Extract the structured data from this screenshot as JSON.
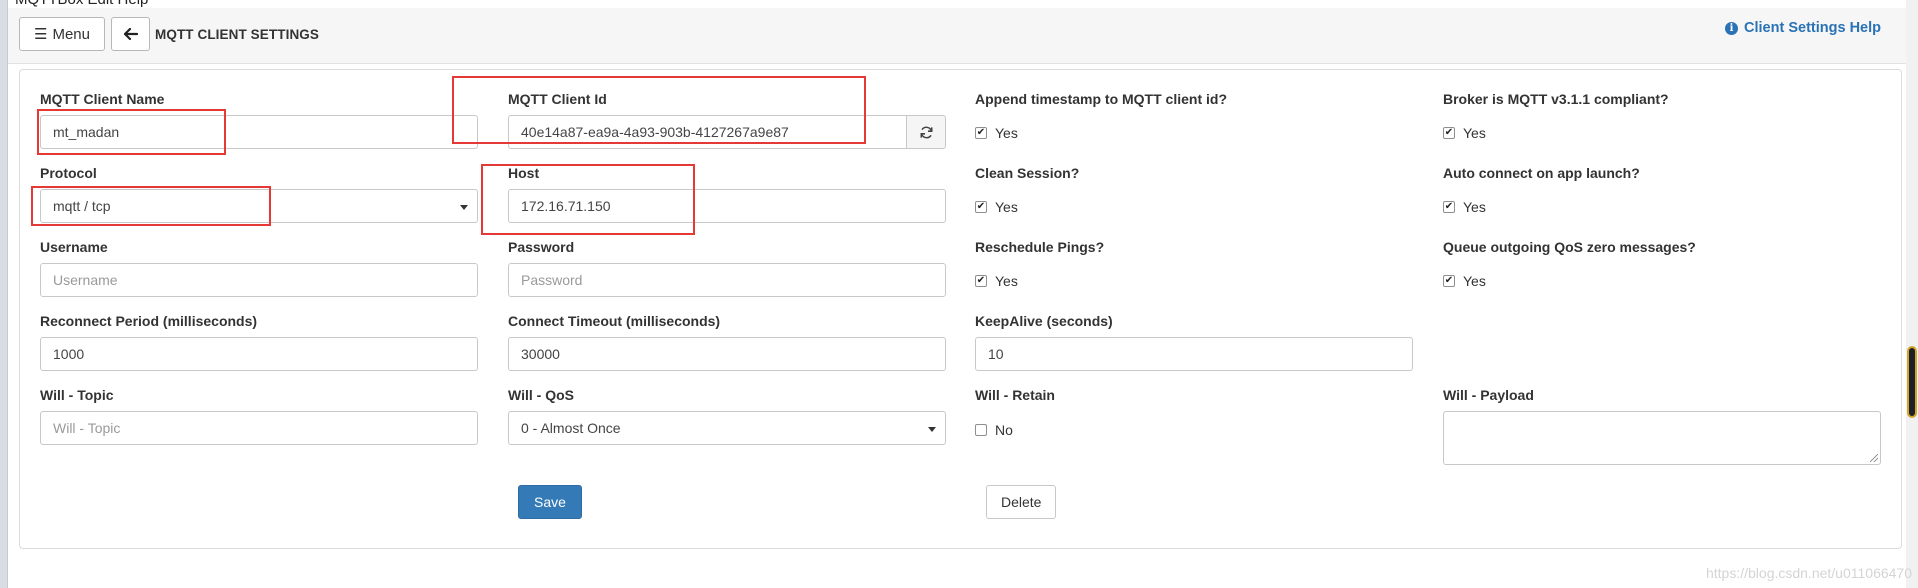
{
  "app": {
    "menubar_text": "MQTTBox  Edit  Help"
  },
  "header": {
    "menu_label": "Menu",
    "title": "MQTT CLIENT SETTINGS",
    "help_label": "Client Settings Help"
  },
  "form": {
    "client_name": {
      "label": "MQTT Client Name",
      "value": "mt_madan"
    },
    "client_id": {
      "label": "MQTT Client Id",
      "value": "40e14a87-ea9a-4a93-903b-4127267a9e87"
    },
    "append_timestamp": {
      "label": "Append timestamp to MQTT client id?",
      "option": "Yes",
      "checked": true
    },
    "mqtt311": {
      "label": "Broker is MQTT v3.1.1 compliant?",
      "option": "Yes",
      "checked": true
    },
    "protocol": {
      "label": "Protocol",
      "value": "mqtt / tcp"
    },
    "host": {
      "label": "Host",
      "value": "172.16.71.150"
    },
    "clean_session": {
      "label": "Clean Session?",
      "option": "Yes",
      "checked": true
    },
    "auto_connect": {
      "label": "Auto connect on app launch?",
      "option": "Yes",
      "checked": true
    },
    "username": {
      "label": "Username",
      "placeholder": "Username"
    },
    "password": {
      "label": "Password",
      "placeholder": "Password"
    },
    "reschedule_pings": {
      "label": "Reschedule Pings?",
      "option": "Yes",
      "checked": true
    },
    "queue_qos0": {
      "label": "Queue outgoing QoS zero messages?",
      "option": "Yes",
      "checked": true
    },
    "reconnect_period": {
      "label": "Reconnect Period (milliseconds)",
      "value": "1000"
    },
    "connect_timeout": {
      "label": "Connect Timeout (milliseconds)",
      "value": "30000"
    },
    "keepalive": {
      "label": "KeepAlive (seconds)",
      "value": "10"
    },
    "will_topic": {
      "label": "Will - Topic",
      "placeholder": "Will - Topic"
    },
    "will_qos": {
      "label": "Will - QoS",
      "value": "0 - Almost Once"
    },
    "will_retain": {
      "label": "Will - Retain",
      "option": "No",
      "checked": false
    },
    "will_payload": {
      "label": "Will - Payload",
      "value": ""
    },
    "save_label": "Save",
    "delete_label": "Delete"
  },
  "watermark": "https://blog.csdn.net/u011066470",
  "colors": {
    "primary": "#337ab7",
    "link": "#2a72b5",
    "annotation_red": "#e53935"
  }
}
